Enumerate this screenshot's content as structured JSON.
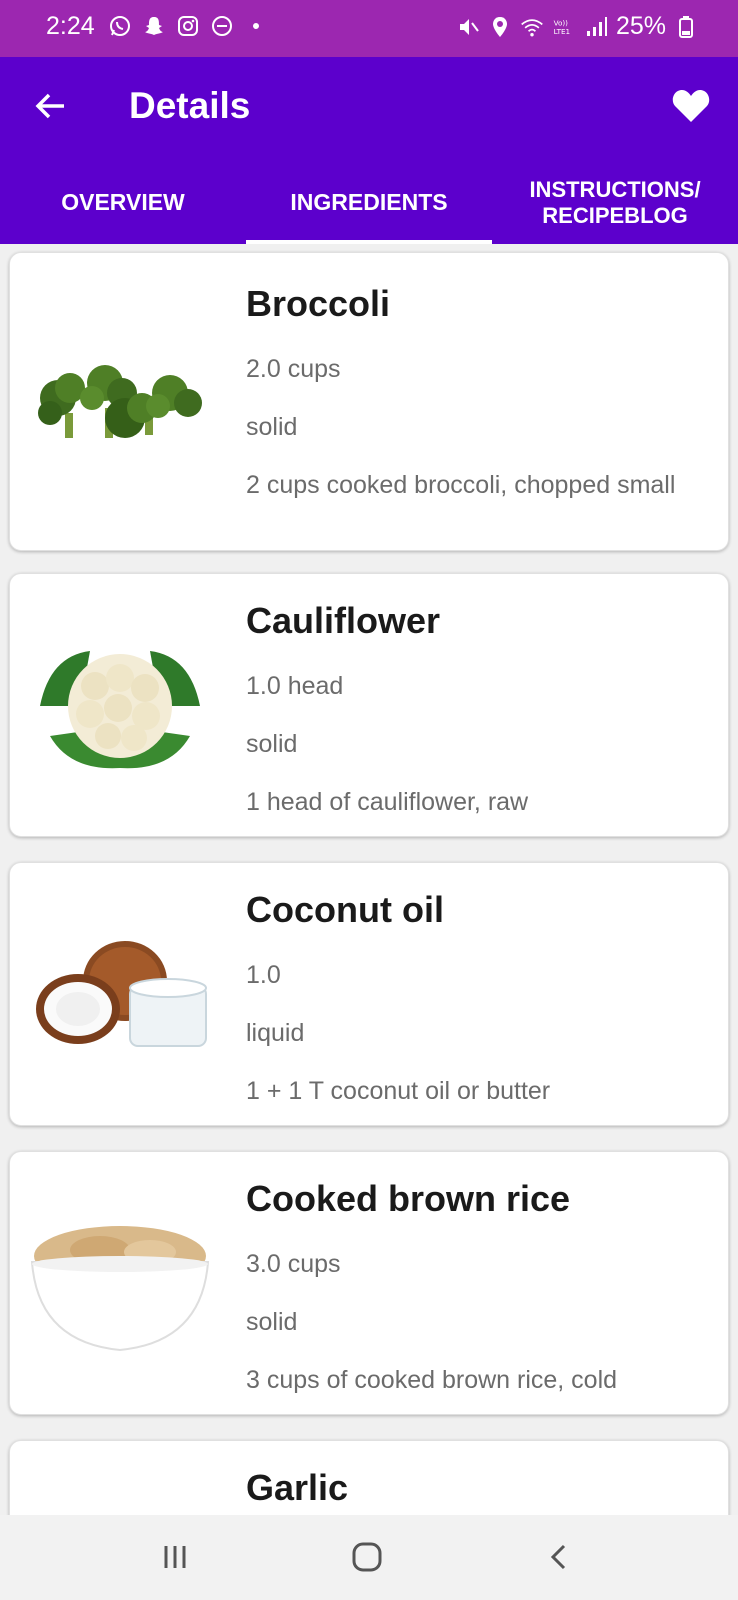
{
  "status_bar": {
    "time": "2:24",
    "battery": "25%",
    "left_icons": [
      "whatsapp-icon",
      "snapchat-icon",
      "instagram-icon",
      "dnd-icon",
      "dot-icon"
    ],
    "right_icons": [
      "mute-icon",
      "location-icon",
      "wifi-icon",
      "volte-icon",
      "signal-icon",
      "battery-icon"
    ]
  },
  "app_bar": {
    "title": "Details",
    "back_icon": "arrow-left-icon",
    "favorite_icon": "heart-icon"
  },
  "tabs": [
    {
      "label": "OVERVIEW",
      "active": false
    },
    {
      "label": "INGREDIENTS",
      "active": true
    },
    {
      "line1": "INSTRUCTIONS/",
      "line2": "RECIPEBLOG",
      "active": false
    }
  ],
  "ingredients": [
    {
      "name": "Broccoli",
      "amount": "2.0  cups",
      "state": "solid",
      "description": "2 cups cooked broccoli, chopped small",
      "image": "broccoli"
    },
    {
      "name": "Cauliflower",
      "amount": "1.0  head",
      "state": "solid",
      "description": "1 head of cauliflower, raw",
      "image": "cauliflower"
    },
    {
      "name": "Coconut oil",
      "amount": "1.0",
      "state": "liquid",
      "description": "1 + 1 T coconut oil or butter",
      "image": "coconut-oil"
    },
    {
      "name": "Cooked brown rice",
      "amount": "3.0  cups",
      "state": "solid",
      "description": "3 cups of cooked brown rice, cold",
      "image": "brown-rice"
    },
    {
      "name": "Garlic"
    }
  ],
  "nav_bar": {
    "icons": [
      "recents-icon",
      "home-icon",
      "back-icon"
    ]
  },
  "colors": {
    "status_bar": "#9c27b0",
    "app_bar": "#5c00cc",
    "card_background": "#ffffff",
    "secondary_text": "#6b6b6b"
  }
}
